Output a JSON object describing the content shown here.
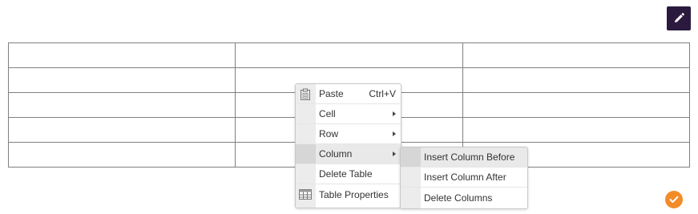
{
  "toolbar": {
    "edit_icon": "pencil-icon",
    "accent": "#2b1a3d"
  },
  "table": {
    "rows": 5,
    "columns": 3
  },
  "context_menu": {
    "items": [
      {
        "label": "Paste",
        "shortcut": "Ctrl+V",
        "icon": "clipboard-icon"
      },
      {
        "label": "Cell",
        "submenu": true
      },
      {
        "label": "Row",
        "submenu": true
      },
      {
        "label": "Column",
        "submenu": true,
        "active": true
      },
      {
        "label": "Delete Table"
      },
      {
        "label": "Table Properties",
        "icon": "table-icon"
      }
    ]
  },
  "column_submenu": {
    "items": [
      {
        "label": "Insert Column Before",
        "active": true
      },
      {
        "label": "Insert Column After"
      },
      {
        "label": "Delete Columns"
      }
    ]
  },
  "status": {
    "icon": "checkmark-icon",
    "color": "#f28c28"
  }
}
